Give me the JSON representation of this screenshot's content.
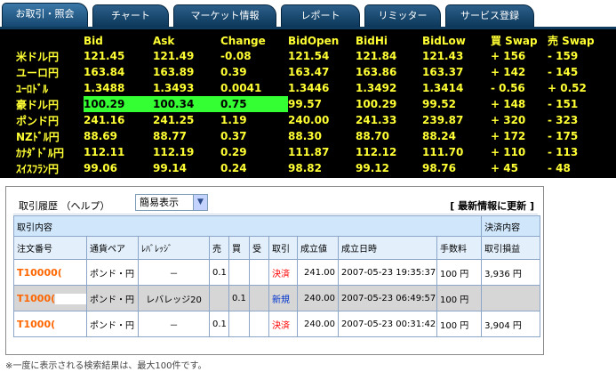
{
  "tabs": [
    {
      "label": "お取引・照会",
      "active": true
    },
    {
      "label": "チャート",
      "active": false
    },
    {
      "label": "マーケット情報",
      "active": false
    },
    {
      "label": "レポート",
      "active": false
    },
    {
      "label": "リミッター",
      "active": false
    },
    {
      "label": "サービス登録",
      "active": false
    }
  ],
  "rates": {
    "columns": [
      "",
      "Bid",
      "Ask",
      "Change",
      "BidOpen",
      "BidHi",
      "BidLow",
      "買 Swap",
      "売 Swap"
    ],
    "rows": [
      {
        "pair": "米ドル円",
        "bid": "121.45",
        "ask": "121.49",
        "change": "-0.08",
        "bid_open": "121.54",
        "bid_hi": "121.84",
        "bid_low": "121.43",
        "buy_swap": "+ 156",
        "sell_swap": "- 159"
      },
      {
        "pair": "ユーロ円",
        "bid": "163.84",
        "ask": "163.89",
        "change": "0.39",
        "bid_open": "163.47",
        "bid_hi": "163.86",
        "bid_low": "163.37",
        "buy_swap": "+ 142",
        "sell_swap": "- 145"
      },
      {
        "pair": "ﾕｰﾛﾄﾞﾙ",
        "bid": "1.3488",
        "ask": "1.3493",
        "change": "0.0041",
        "bid_open": "1.3446",
        "bid_hi": "1.3492",
        "bid_low": "1.3414",
        "buy_swap": "- 0.56",
        "sell_swap": "+ 0.52"
      },
      {
        "pair": "豪ドル円",
        "bid": "100.29",
        "ask": "100.34",
        "change": "0.75",
        "bid_open": "99.57",
        "bid_hi": "100.29",
        "bid_low": "99.52",
        "buy_swap": "+ 148",
        "sell_swap": "- 151",
        "highlight": true
      },
      {
        "pair": "ポンド円",
        "bid": "241.16",
        "ask": "241.25",
        "change": "1.19",
        "bid_open": "240.00",
        "bid_hi": "241.33",
        "bid_low": "239.87",
        "buy_swap": "+ 320",
        "sell_swap": "- 323"
      },
      {
        "pair": "NZﾄﾞﾙ円",
        "bid": "88.69",
        "ask": "88.77",
        "change": "0.37",
        "bid_open": "88.30",
        "bid_hi": "88.70",
        "bid_low": "88.24",
        "buy_swap": "+ 172",
        "sell_swap": "- 175"
      },
      {
        "pair": "ｶﾅﾀﾞﾄﾞﾙ円",
        "bid": "112.11",
        "ask": "112.19",
        "change": "0.29",
        "bid_open": "111.87",
        "bid_hi": "112.12",
        "bid_low": "111.70",
        "buy_swap": "+ 110",
        "sell_swap": "- 113"
      },
      {
        "pair": "ｽｲｽﾌﾗﾝ円",
        "bid": "99.06",
        "ask": "99.14",
        "change": "0.24",
        "bid_open": "98.82",
        "bid_hi": "99.12",
        "bid_low": "98.76",
        "buy_swap": "+ 45",
        "sell_swap": "- 48"
      }
    ]
  },
  "history": {
    "title": "取引履歴 （ヘルプ）",
    "view_select": "簡易表示",
    "refresh_label": "[ 最新情報に更新 ]",
    "section_trade": "取引内容",
    "section_settle": "決済内容",
    "columns": [
      "注文番号",
      "通貨ペア",
      "ﾚﾊﾞﾚｯｼﾞ",
      "売",
      "買",
      "受",
      "取引",
      "成立値",
      "成立日時",
      "手数料",
      "取引損益"
    ],
    "rows": [
      {
        "order": "T10000(",
        "pair": "ポンド・円",
        "leverage": "－",
        "sell": "0.1",
        "buy": "",
        "recv": "",
        "kind": "決済",
        "kind_type": "close",
        "price": "241.00",
        "datetime": "2007-05-23 19:35:37",
        "fee": "100 円",
        "pnl": "3,936 円",
        "gray": false
      },
      {
        "order": "T1000(",
        "pair": "ポンド・円",
        "leverage": "レバレッジ20",
        "sell": "",
        "buy": "0.1",
        "recv": "",
        "kind": "新規",
        "kind_type": "new",
        "price": "240.00",
        "datetime": "2007-05-23 06:49:57",
        "fee": "100 円",
        "pnl": "",
        "gray": true
      },
      {
        "order": "T1000(",
        "pair": "ポンド・円",
        "leverage": "－",
        "sell": "0.1",
        "buy": "",
        "recv": "",
        "kind": "決済",
        "kind_type": "close",
        "price": "240.00",
        "datetime": "2007-05-23 00:31:42",
        "fee": "100 円",
        "pnl": "3,904 円",
        "gray": false
      }
    ],
    "footnote": "※一度に表示される検索結果は、最大100件です。"
  },
  "colors": {
    "rate_text": "#ffff33",
    "rate_bg": "#000000",
    "highlight": "#33ff33",
    "tab_bg": "#0b3658",
    "order_no": "#ff6600",
    "close_kind": "#ff0000",
    "new_kind": "#0033cc"
  }
}
